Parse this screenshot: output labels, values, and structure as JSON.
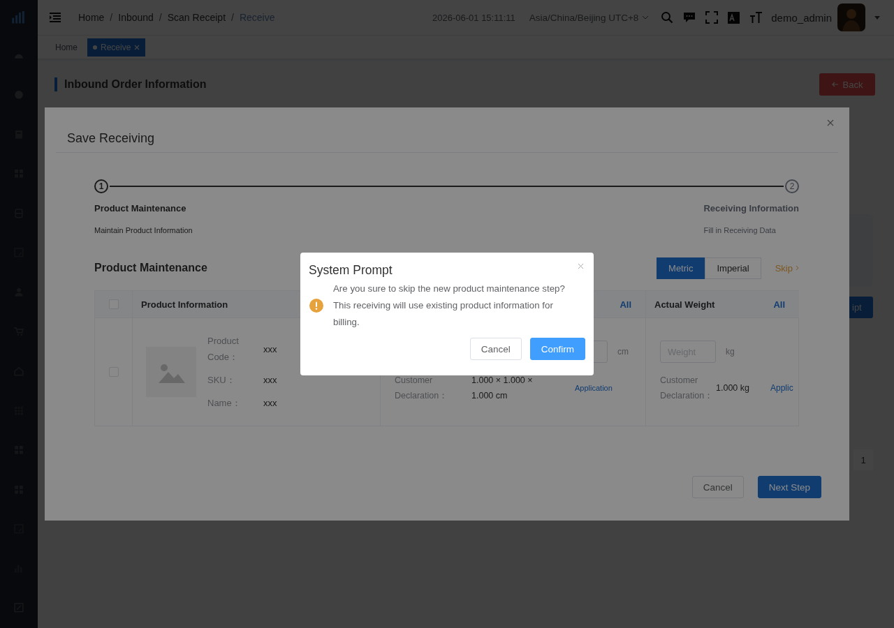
{
  "header": {
    "breadcrumb_separator": "/",
    "breadcrumbs": [
      {
        "label": "Home",
        "current": false
      },
      {
        "label": "Inbound",
        "current": false
      },
      {
        "label": "Scan Receipt",
        "current": false
      },
      {
        "label": "Receive",
        "current": true
      }
    ],
    "datetime": "2026-06-01 15:11:11",
    "timezone": "Asia/China/Beijing UTC+8",
    "username": "demo_admin"
  },
  "tags": [
    {
      "label": "Home",
      "selected": false,
      "closable": false
    },
    {
      "label": "Receive",
      "selected": true,
      "closable": true
    }
  ],
  "page": {
    "section_title": "Inbound Order Information",
    "back_button": "Back",
    "partial_button": "ipt",
    "pagination_page": "1"
  },
  "modal": {
    "title": "Save Receiving",
    "steps": [
      {
        "number": "1",
        "title": "Product Maintenance",
        "description": "Maintain Product Information",
        "active": true
      },
      {
        "number": "2",
        "title": "Receiving Information",
        "description": "Fill in Receiving Data",
        "active": false
      }
    ],
    "section_title": "Product Maintenance",
    "units": [
      {
        "label": "Metric",
        "selected": true
      },
      {
        "label": "Imperial",
        "selected": false
      }
    ],
    "skip_link": "Skip",
    "table": {
      "columns": [
        {
          "kind": "check",
          "checked": false
        },
        {
          "kind": "text",
          "label": "Product Information"
        },
        {
          "kind": "all",
          "action": "All"
        },
        {
          "kind": "text",
          "label": "Actual Weight",
          "action": "All"
        }
      ],
      "row": {
        "checked": false,
        "product": [
          {
            "label": "Product Code：",
            "value": "xxx"
          },
          {
            "label": "SKU：",
            "value": "xxx"
          },
          {
            "label": "Name：",
            "value": "xxx"
          }
        ],
        "dimensions": {
          "unit": "cm",
          "declaration_label": "Customer Declaration：",
          "declaration_value": "1.000 × 1.000 × 1.000 cm",
          "apply_link": "Application"
        },
        "weight": {
          "placeholder": "Weight",
          "unit": "kg",
          "declaration_label": "Customer Declaration：",
          "declaration_value": "1.000 kg",
          "apply_link": "Applic"
        }
      }
    },
    "buttons": [
      {
        "label": "Cancel",
        "kind": "plain"
      },
      {
        "label": "Next Step",
        "kind": "primary"
      }
    ]
  },
  "prompt": {
    "title": "System Prompt",
    "message": "Are you sure to skip the new product maintenance step? This receiving will use existing product information for billing.",
    "buttons": [
      {
        "label": "Cancel",
        "kind": "plain"
      },
      {
        "label": "Confirm",
        "kind": "primary"
      }
    ]
  }
}
